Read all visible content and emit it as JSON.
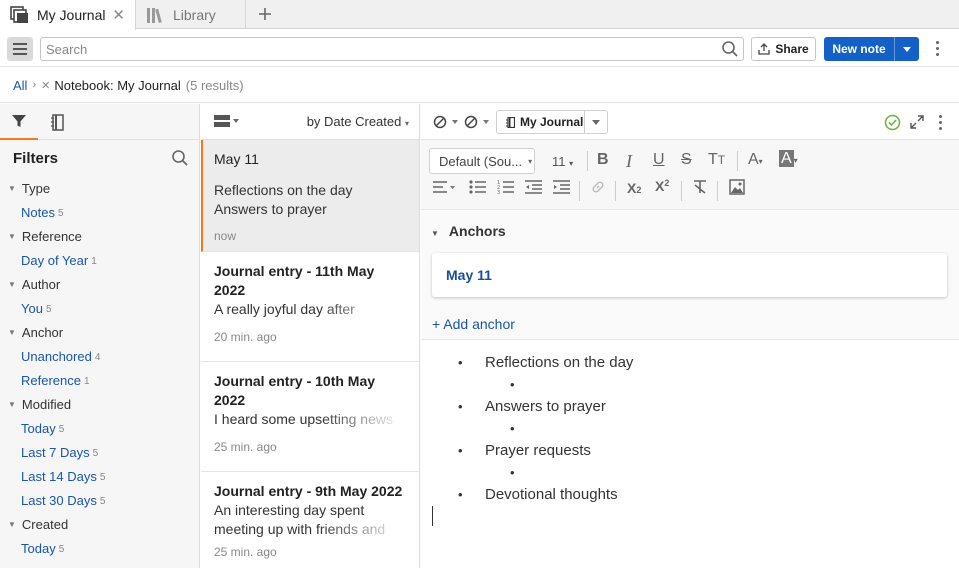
{
  "tabs": [
    {
      "label": "My Journal",
      "active": true,
      "icon": "journal-stack-icon"
    },
    {
      "label": "Library",
      "active": false,
      "icon": "library-books-icon"
    }
  ],
  "toolbar": {
    "search_placeholder": "Search",
    "share_label": "Share",
    "new_note_label": "New note"
  },
  "breadcrumb": {
    "root": "All",
    "filter": "Notebook: My Journal",
    "results": "(5 results)"
  },
  "filters": {
    "title": "Filters",
    "groups": [
      {
        "label": "Type",
        "items": [
          {
            "label": "Notes",
            "count": "5"
          }
        ]
      },
      {
        "label": "Reference",
        "items": [
          {
            "label": "Day of Year",
            "count": "1"
          }
        ]
      },
      {
        "label": "Author",
        "items": [
          {
            "label": "You",
            "count": "5"
          }
        ]
      },
      {
        "label": "Anchor",
        "items": [
          {
            "label": "Unanchored",
            "count": "4"
          },
          {
            "label": "Reference",
            "count": "1"
          }
        ]
      },
      {
        "label": "Modified",
        "items": [
          {
            "label": "Today",
            "count": "5"
          },
          {
            "label": "Last 7 Days",
            "count": "5"
          },
          {
            "label": "Last 14 Days",
            "count": "5"
          },
          {
            "label": "Last 30 Days",
            "count": "5"
          }
        ]
      },
      {
        "label": "Created",
        "items": [
          {
            "label": "Today",
            "count": "5"
          }
        ]
      }
    ]
  },
  "notes_list": {
    "sort_label": "by Date Created",
    "notes": [
      {
        "title": "May 11",
        "lines": [
          "Reflections on the day",
          "Answers to prayer"
        ],
        "time": "now"
      },
      {
        "title": "Journal entry - 11th May 2022",
        "lines": [
          "A really joyful day after"
        ],
        "time": "20 min. ago"
      },
      {
        "title": "Journal entry - 10th May 2022",
        "lines": [
          "I heard some upsetting news"
        ],
        "time": "25 min. ago"
      },
      {
        "title": "Journal entry - 9th May 2022",
        "lines": [
          "An interesting day spent",
          "meeting up with friends and"
        ],
        "time": "25 min. ago"
      }
    ]
  },
  "editor": {
    "notebook_label": "My Journal",
    "font_label": "Default (Sou...",
    "font_size": "11",
    "anchors_label": "Anchors",
    "anchor_value": "May 11",
    "add_anchor_label": "+ Add anchor",
    "bullets": [
      "Reflections on the day",
      "Answers to prayer",
      "Prayer requests",
      "Devotional thoughts"
    ]
  },
  "colors": {
    "accent": "#f07a20",
    "primary_button": "#1360c7",
    "link": "#1a55a8",
    "success": "#6cb33f"
  }
}
